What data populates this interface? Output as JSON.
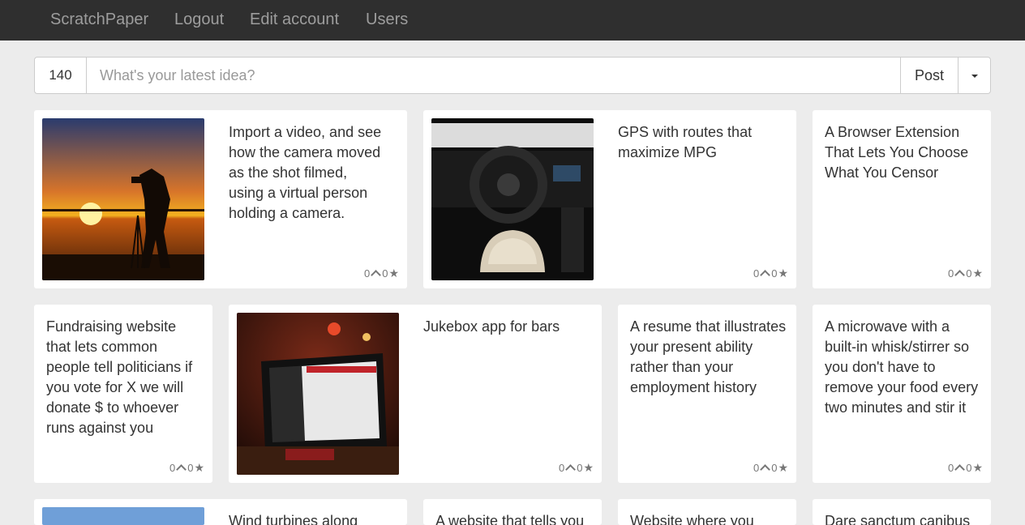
{
  "navbar": {
    "brand": "ScratchPaper",
    "links": [
      "Logout",
      "Edit account",
      "Users"
    ]
  },
  "composer": {
    "counter": "140",
    "placeholder": "What's your latest idea?",
    "post_label": "Post"
  },
  "cards": [
    {
      "text": "Import a video, and see how the camera moved as the shot filmed, using a virtual person holding a camera.",
      "image": "sunset photographer",
      "votes": "0",
      "stars": "0"
    },
    {
      "text": "GPS with routes that maximize MPG",
      "image": "car interior steering wheel",
      "votes": "0",
      "stars": "0"
    },
    {
      "text": "A Browser Extension That Lets You Choose What You Censor",
      "votes": "0",
      "stars": "0"
    },
    {
      "text": "Fundraising website that lets common people tell politicians if you vote for X we will donate $ to whoever runs against you",
      "votes": "0",
      "stars": "0"
    },
    {
      "text": "Jukebox app for bars",
      "image": "tablet on bar counter",
      "votes": "0",
      "stars": "0"
    },
    {
      "text": "A resume that illustrates your present ability rather than your employment history",
      "votes": "0",
      "stars": "0"
    },
    {
      "text": "A microwave with a built-in whisk/stirrer so you don't have to remove your food every two minutes and stir it",
      "votes": "0",
      "stars": "0"
    },
    {
      "text": "Wind turbines along",
      "image": "sky",
      "votes": "",
      "stars": ""
    },
    {
      "text": "A website that tells you",
      "votes": "",
      "stars": ""
    },
    {
      "text": "Website where you",
      "votes": "",
      "stars": ""
    },
    {
      "text": "Dare sanctum canibus",
      "votes": "",
      "stars": ""
    }
  ],
  "colors": {
    "navbar_bg": "#2f2f2f",
    "page_bg": "#ececec",
    "card_bg": "#ffffff"
  }
}
